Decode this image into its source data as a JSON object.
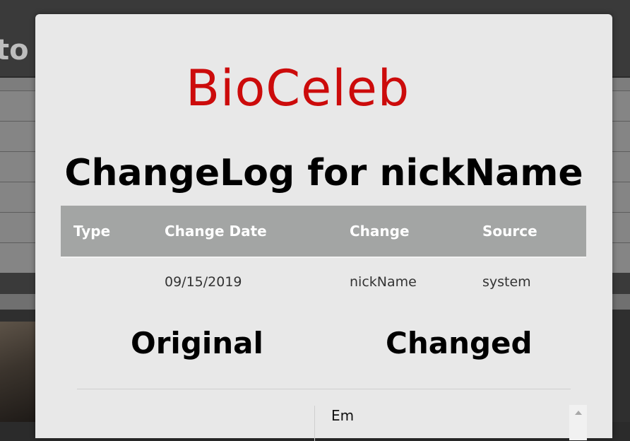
{
  "background": {
    "title_fragment": "to"
  },
  "modal": {
    "logo_text": "BioCeleb",
    "title": "ChangeLog for nickName",
    "table": {
      "headers": [
        "Type",
        "Change Date",
        "Change",
        "Source"
      ],
      "rows": [
        [
          "",
          "09/15/2019",
          "nickName",
          "system"
        ]
      ]
    },
    "compare": {
      "original_label": "Original",
      "changed_label": "Changed",
      "changed_value": "Em"
    }
  },
  "colors": {
    "logo": "#cc0b0b",
    "table_header_bg": "#a3a5a4",
    "modal_bg": "#e8e8e8"
  }
}
